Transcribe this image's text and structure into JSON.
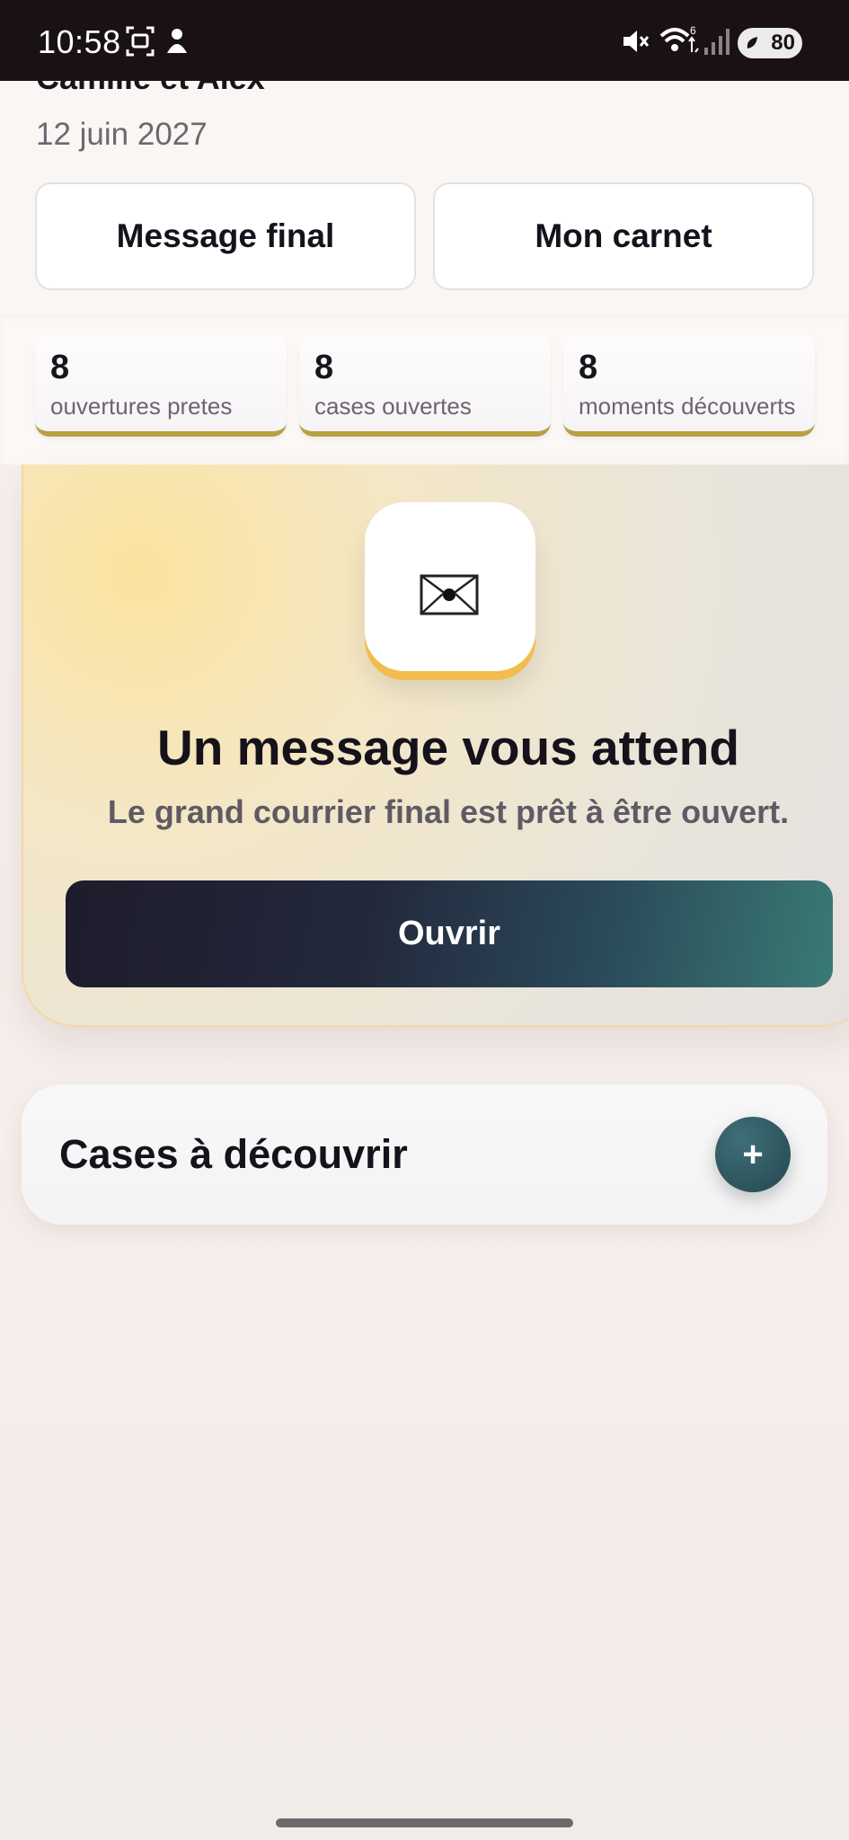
{
  "status_bar": {
    "time": "10:58",
    "battery": "80",
    "network": "6"
  },
  "header": {
    "couple_name": "Camille et Alex",
    "date": "12 juin 2027",
    "final_message_button": "Message final",
    "notebook_button": "Mon carnet"
  },
  "stats": [
    {
      "value": "8",
      "label": "ouvertures pretes"
    },
    {
      "value": "8",
      "label": "cases ouvertes"
    },
    {
      "value": "8",
      "label": "moments découverts"
    }
  ],
  "message_card": {
    "icon": "envelope-icon",
    "title": "Un message vous attend",
    "subtitle": "Le grand courrier final est prêt à être ouvert.",
    "open_button": "Ouvrir"
  },
  "cases": {
    "title": "Cases à découvrir",
    "add_label": "+"
  },
  "colors": {
    "accent_gold": "#b8a042",
    "envelope_shadow": "#f2bd4c",
    "button_dark": "#1e1c2c",
    "button_teal": "#3a7a74"
  }
}
